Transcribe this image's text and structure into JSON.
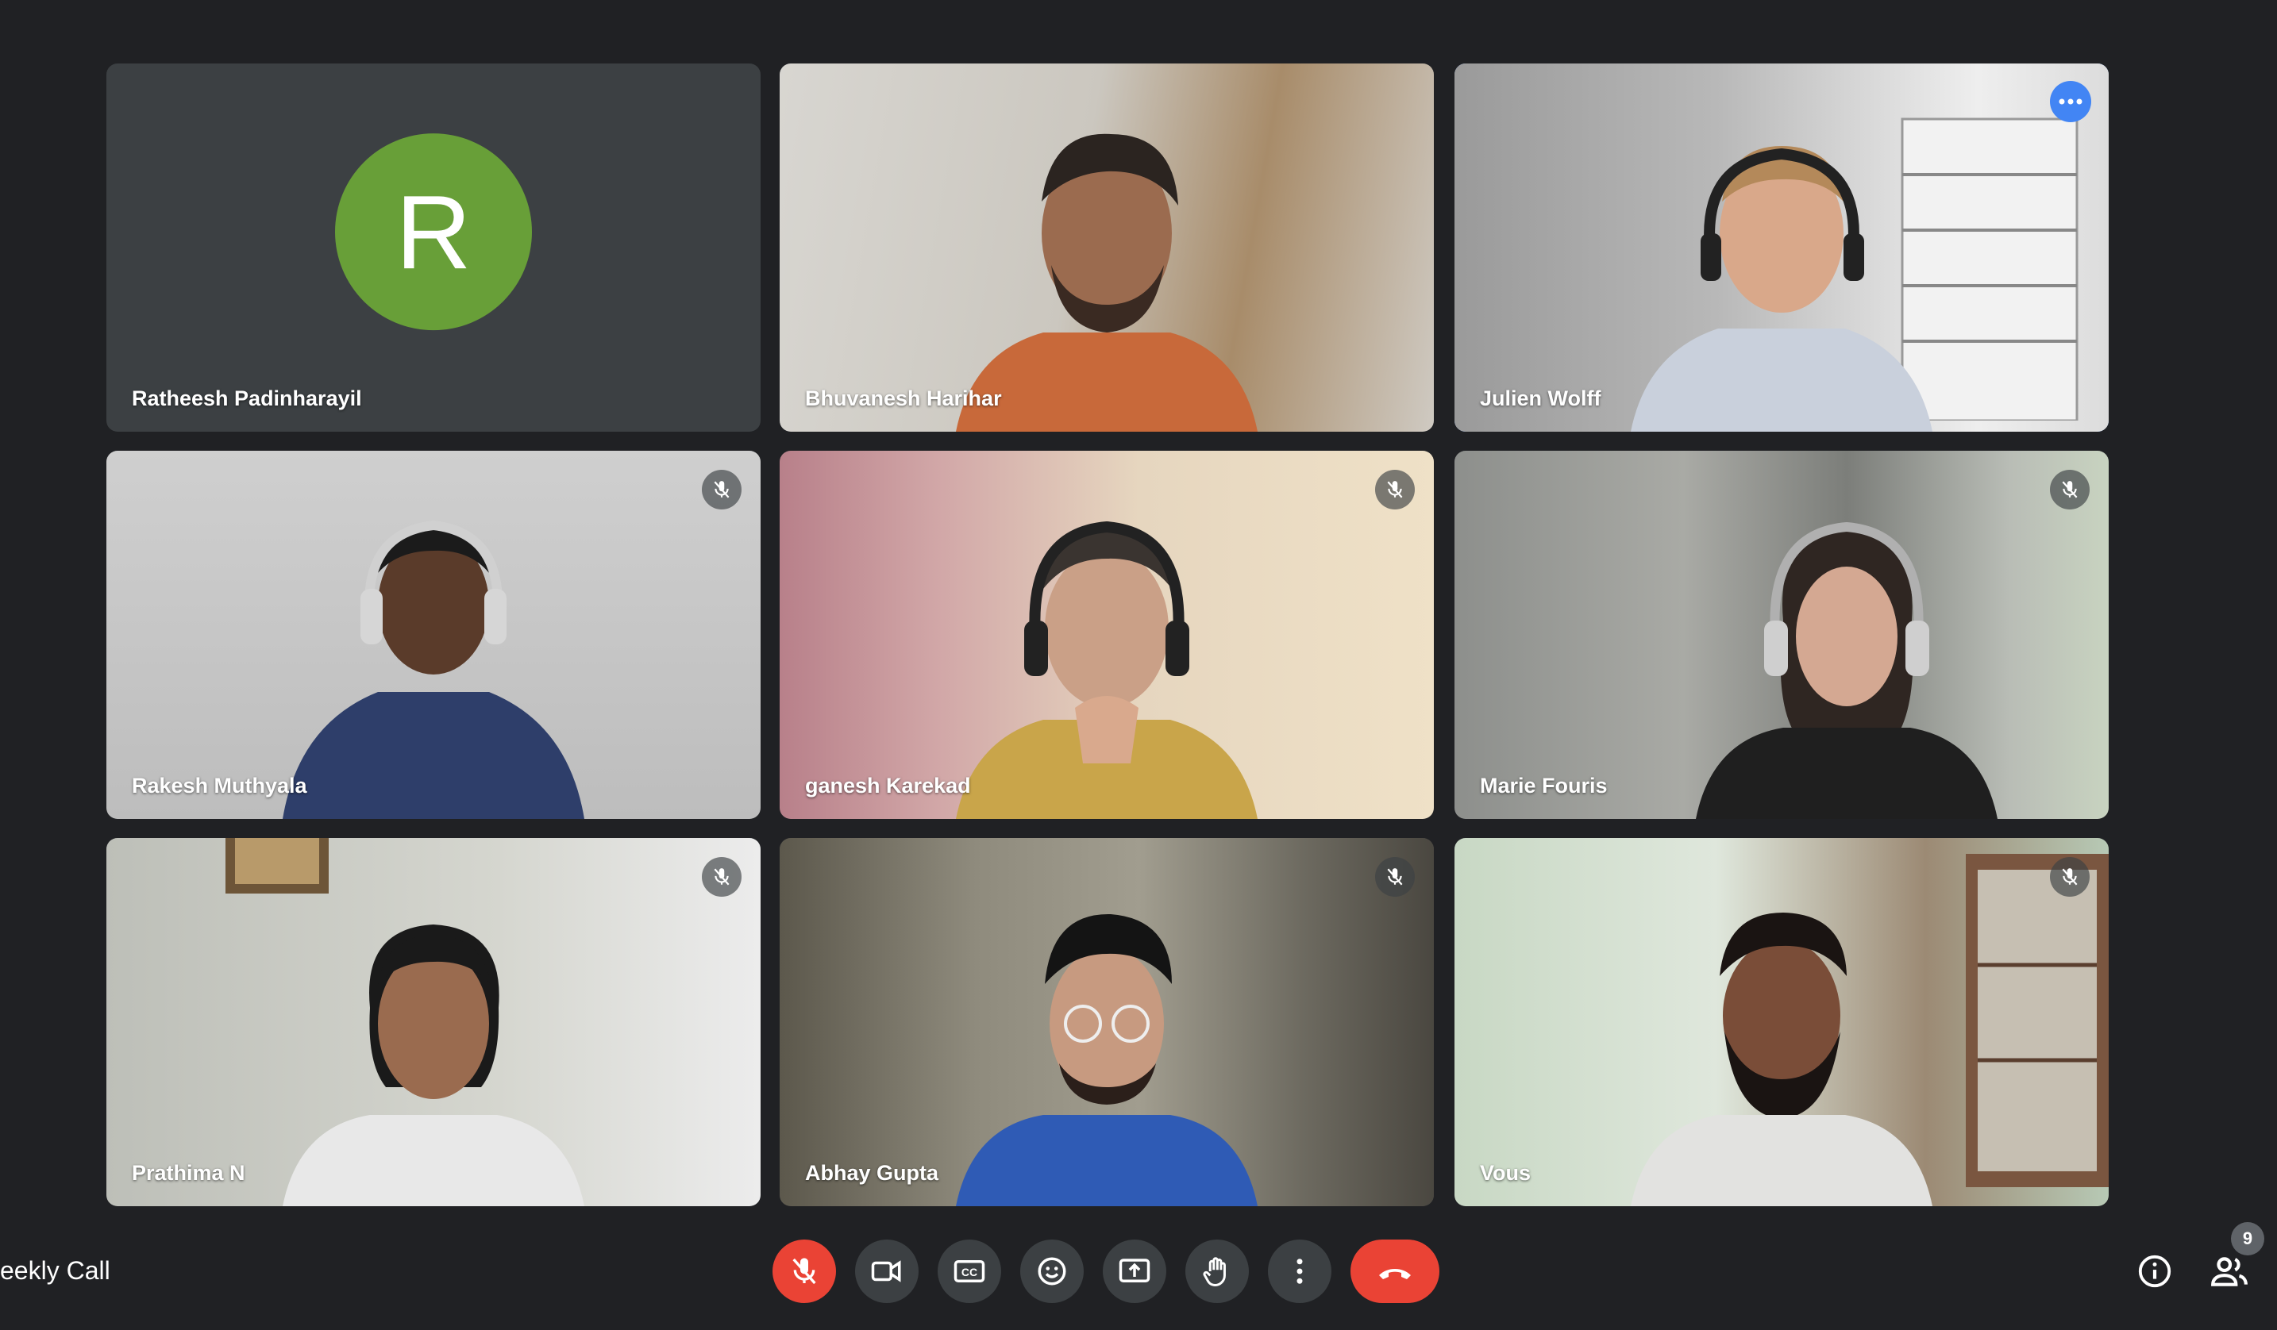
{
  "meeting": {
    "title": "eekly Call",
    "participant_count": "9"
  },
  "participants": [
    {
      "name": "Ratheesh Padinharayil",
      "avatar_letter": "R",
      "avatar_color": "#689f38",
      "muted": false,
      "video": false
    },
    {
      "name": "Bhuvanesh Harihar",
      "muted": false,
      "video": true
    },
    {
      "name": "Julien Wolff",
      "muted": false,
      "video": true,
      "active_speaker": true
    },
    {
      "name": "Rakesh Muthyala",
      "muted": true,
      "video": true
    },
    {
      "name": "ganesh Karekad",
      "muted": true,
      "video": true
    },
    {
      "name": "Marie Fouris",
      "muted": true,
      "video": true
    },
    {
      "name": "Prathima N",
      "muted": true,
      "video": true
    },
    {
      "name": "Abhay Gupta",
      "muted": true,
      "video": true
    },
    {
      "name": "Vous",
      "muted": true,
      "video": true
    }
  ],
  "controls": {
    "icons": [
      "mic-off-icon",
      "camera-icon",
      "captions-icon",
      "emoji-icon",
      "present-icon",
      "raise-hand-icon",
      "more-options-icon",
      "end-call-icon"
    ],
    "right_icons": [
      "info-icon",
      "people-icon"
    ]
  },
  "colors": {
    "background": "#202124",
    "tile": "#3c4043",
    "active_border": "#8ab4f8",
    "danger": "#ea4335"
  }
}
